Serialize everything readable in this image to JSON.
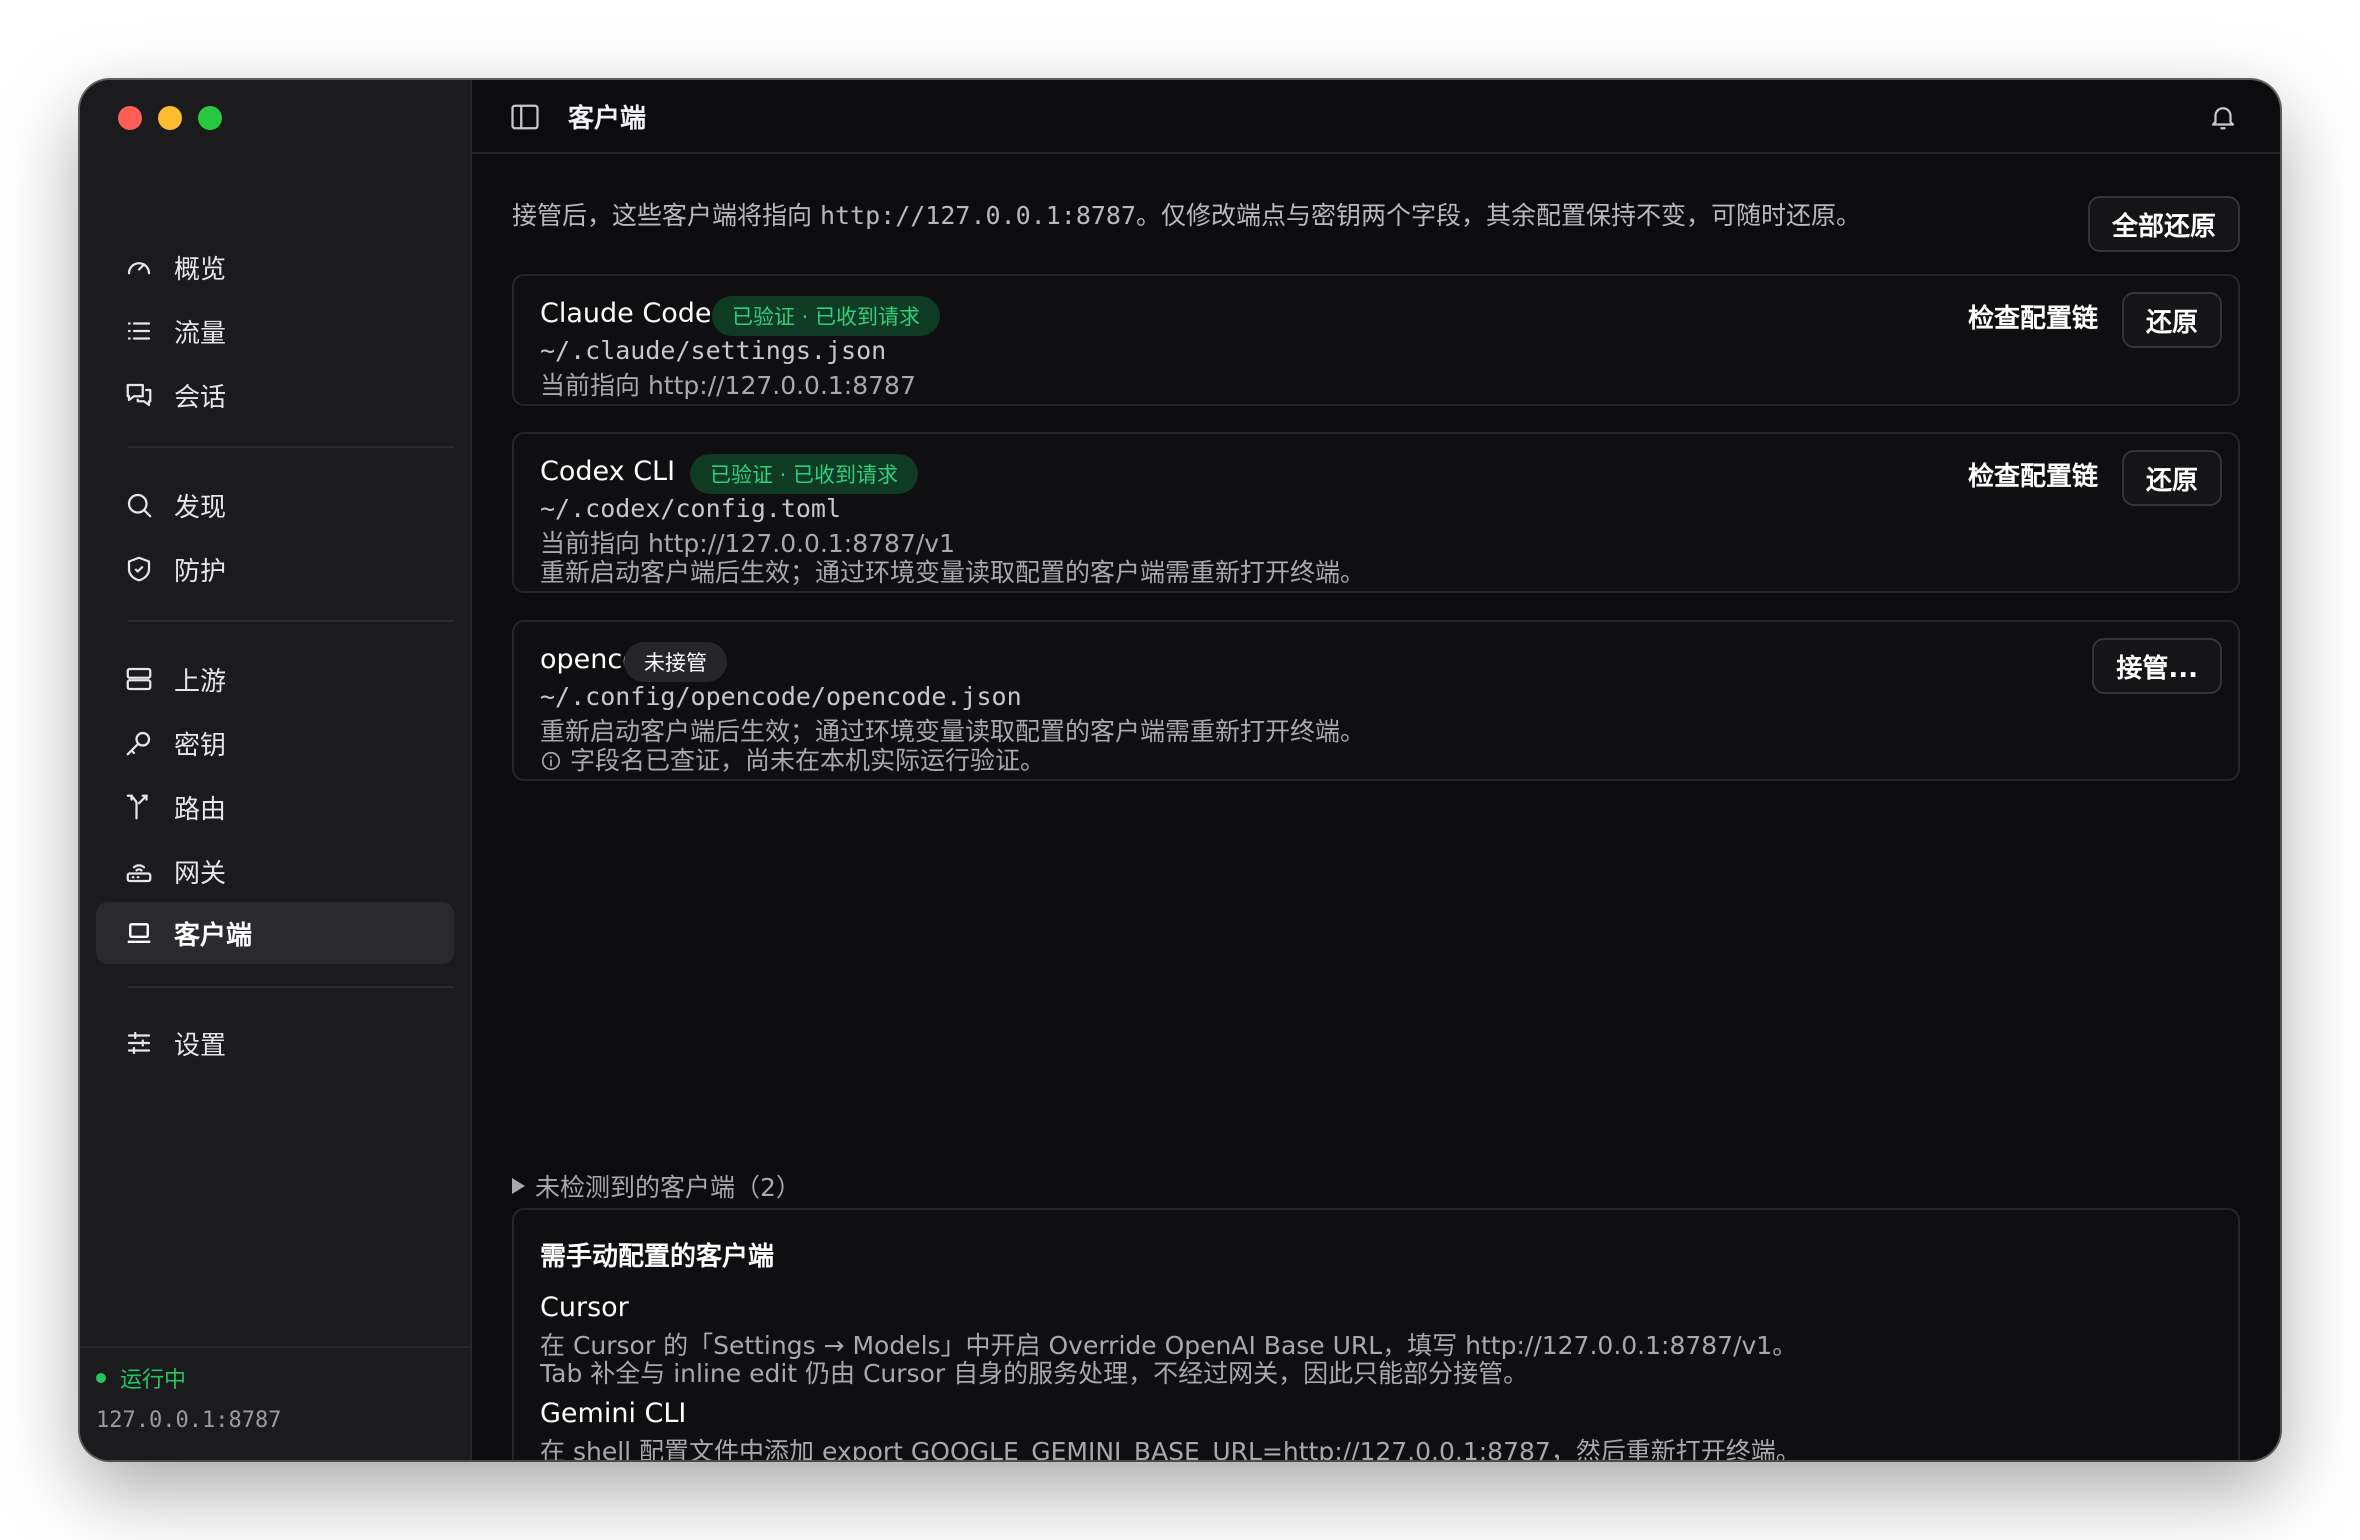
{
  "sidebar": {
    "items": [
      {
        "label": "概览",
        "icon": "gauge-icon"
      },
      {
        "label": "流量",
        "icon": "list-icon"
      },
      {
        "label": "会话",
        "icon": "chat-icon"
      },
      {
        "label": "发现",
        "icon": "search-icon"
      },
      {
        "label": "防护",
        "icon": "shield-icon"
      },
      {
        "label": "上游",
        "icon": "server-icon"
      },
      {
        "label": "密钥",
        "icon": "key-icon"
      },
      {
        "label": "路由",
        "icon": "route-icon"
      },
      {
        "label": "网关",
        "icon": "gateway-icon"
      },
      {
        "label": "客户端",
        "icon": "laptop-icon",
        "active": true
      },
      {
        "label": "设置",
        "icon": "sliders-icon"
      }
    ],
    "status": "运行中",
    "address": "127.0.0.1:8787",
    "status_color": "#22c55e"
  },
  "topbar": {
    "title": "客户端"
  },
  "intro": {
    "text_before": "接管后，这些客户端将指向 ",
    "url": "http://127.0.0.1:8787",
    "text_after": "。仅修改端点与密钥两个字段，其余配置保持不变，可随时还原。",
    "restore_all": "全部还原"
  },
  "clients": [
    {
      "name": "Claude Code",
      "badge": "已验证 · 已收到请求",
      "path": "~/.claude/settings.json",
      "pointing": "当前指向 http://127.0.0.1:8787",
      "check_label": "检查配置链",
      "restore_label": "还原"
    },
    {
      "name": "Codex CLI",
      "badge": "已验证 · 已收到请求",
      "path": "~/.codex/config.toml",
      "pointing": "当前指向 http://127.0.0.1:8787/v1",
      "note": "重新启动客户端后生效；通过环境变量读取配置的客户端需重新打开终端。",
      "check_label": "检查配置链",
      "restore_label": "还原"
    },
    {
      "name": "opencode",
      "badge": "未接管",
      "path": "~/.config/opencode/opencode.json",
      "note": "重新启动客户端后生效；通过环境变量读取配置的客户端需重新打开终端。",
      "info": "字段名已查证，尚未在本机实际运行验证。",
      "takeover_label": "接管..."
    }
  ],
  "undetected": "未检测到的客户端（2）",
  "manual": {
    "heading": "需手动配置的客户端",
    "items": [
      {
        "name": "Cursor",
        "line1": "在 Cursor 的「Settings → Models」中开启 Override OpenAI Base URL，填写 http://127.0.0.1:8787/v1。",
        "line2": "Tab 补全与 inline edit 仍由 Cursor 自身的服务处理，不经过网关，因此只能部分接管。"
      },
      {
        "name": "Gemini CLI",
        "line1": "在 shell 配置文件中添加 export GOOGLE_GEMINI_BASE_URL=http://127.0.0.1:8787，然后重新打开终端。"
      }
    ]
  },
  "colors": {
    "accent_green": "#2fd07a",
    "badge_green_bg": "#0f3a24"
  }
}
